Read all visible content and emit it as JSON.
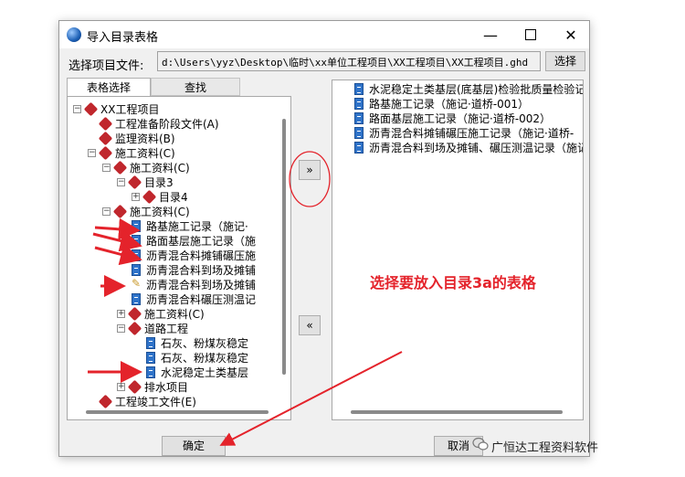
{
  "window": {
    "title": "导入目录表格",
    "file_label": "选择项目文件:",
    "file_path": "d:\\Users\\yyz\\Desktop\\临时\\xx单位工程项目\\XX工程项目\\XX工程项目.ghd",
    "browse_label": "选择"
  },
  "tabs": [
    {
      "label": "表格选择"
    },
    {
      "label": "查找"
    }
  ],
  "tree": [
    {
      "label": "XX工程项目"
    },
    {
      "label": "工程准备阶段文件(A)"
    },
    {
      "label": "监理资料(B)"
    },
    {
      "label": "施工资料(C)"
    },
    {
      "label": "施工资料(C)"
    },
    {
      "label": "目录3"
    },
    {
      "label": "目录4"
    },
    {
      "label": "施工资料(C)"
    },
    {
      "label": "路基施工记录（施记·"
    },
    {
      "label": "路面基层施工记录（施"
    },
    {
      "label": "沥青混合料摊铺碾压施"
    },
    {
      "label": "沥青混合料到场及摊铺"
    },
    {
      "label": "沥青混合料到场及摊铺"
    },
    {
      "label": "沥青混合料碾压测温记"
    },
    {
      "label": "施工资料(C)"
    },
    {
      "label": "道路工程"
    },
    {
      "label": "石灰、粉煤灰稳定"
    },
    {
      "label": "石灰、粉煤灰稳定"
    },
    {
      "label": "水泥稳定土类基层"
    },
    {
      "label": "排水项目"
    },
    {
      "label": "工程竣工文件(E)"
    }
  ],
  "selected": [
    {
      "label": "水泥稳定土类基层(底基层)检验批质量检验记"
    },
    {
      "label": "路基施工记录（施记·道桥-001）"
    },
    {
      "label": "路面基层施工记录（施记·道桥-002）"
    },
    {
      "label": "沥青混合料摊铺碾压施工记录（施记·道桥-"
    },
    {
      "label": "沥青混合料到场及摊铺、碾压测温记录（施记"
    }
  ],
  "buttons": {
    "move_right": "»",
    "move_left": "«",
    "ok": "确定",
    "cancel": "取消"
  },
  "annotation": "选择要放入目录3a的表格",
  "watermark": "广恒达工程资料软件",
  "colors": {
    "annotation_red": "#e4232b",
    "book_icon_red": "#c0272d",
    "doc_icon_blue": "#2f73c9"
  }
}
